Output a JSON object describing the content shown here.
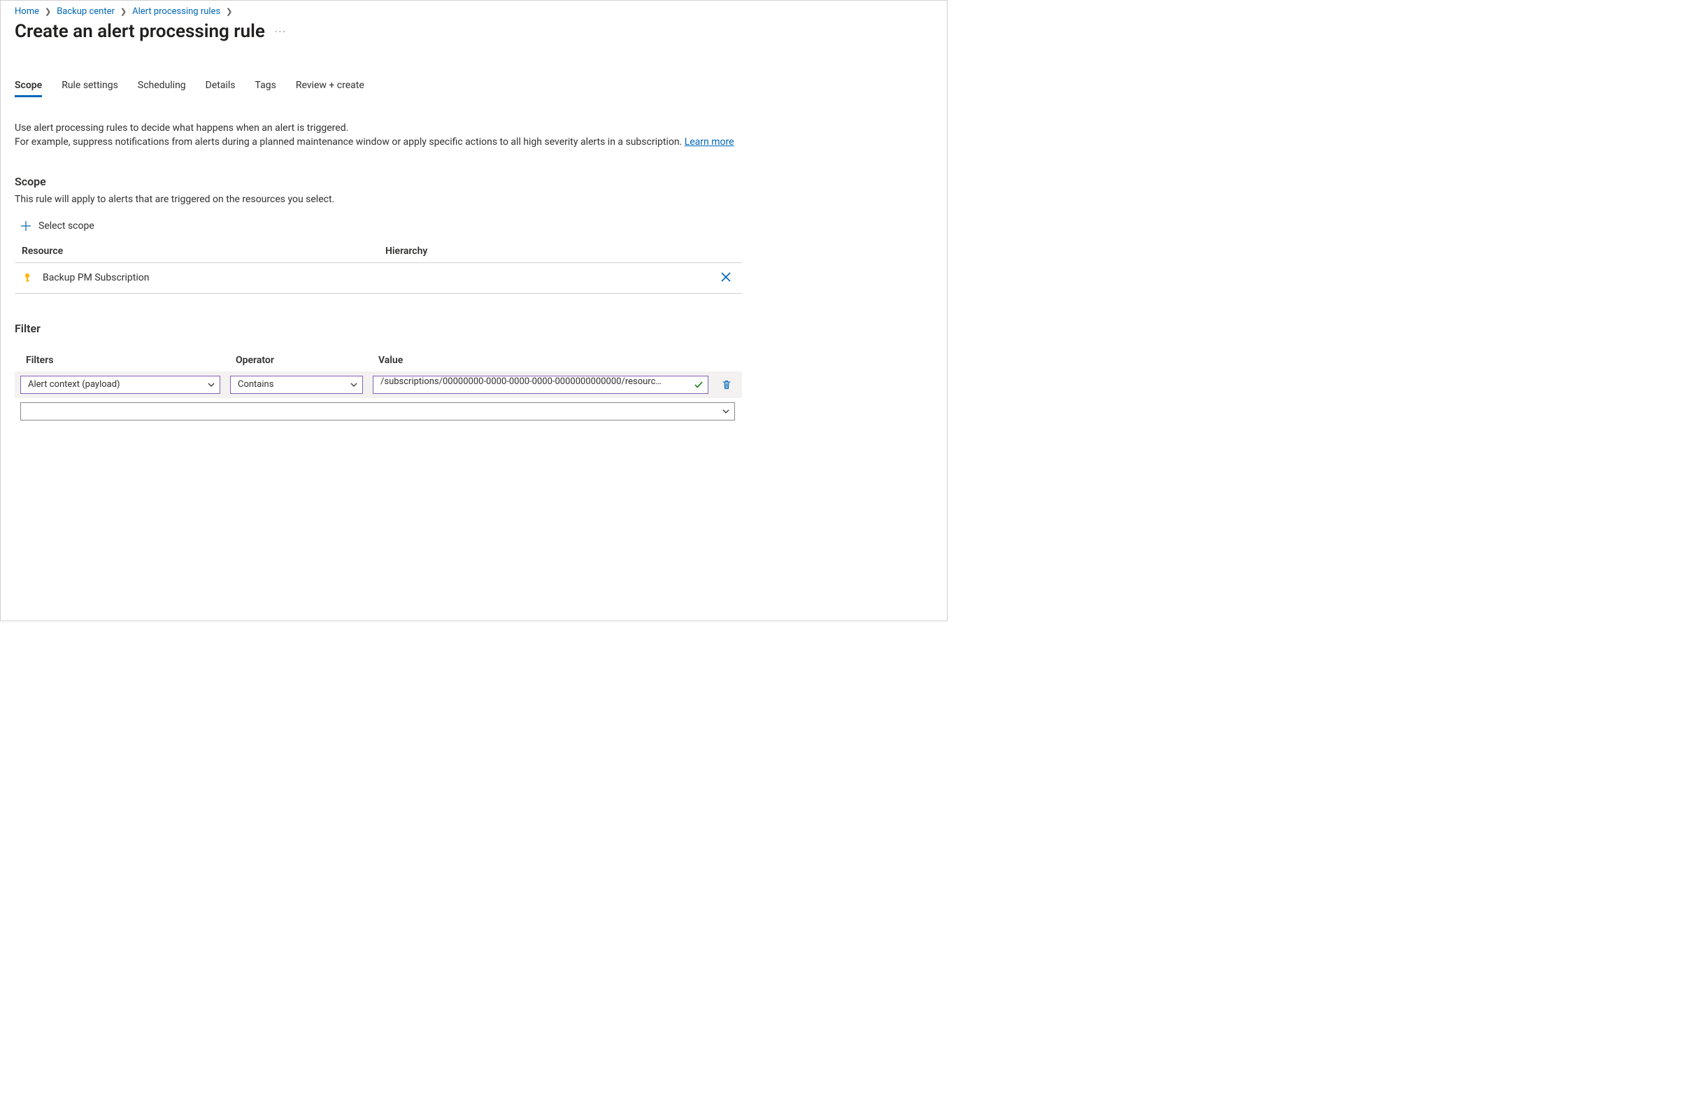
{
  "breadcrumb": {
    "items": [
      {
        "label": "Home"
      },
      {
        "label": "Backup center"
      },
      {
        "label": "Alert processing rules"
      }
    ]
  },
  "page": {
    "title": "Create an alert processing rule"
  },
  "tabs": [
    {
      "label": "Scope",
      "active": true
    },
    {
      "label": "Rule settings"
    },
    {
      "label": "Scheduling"
    },
    {
      "label": "Details"
    },
    {
      "label": "Tags"
    },
    {
      "label": "Review + create"
    }
  ],
  "description": {
    "line1": "Use alert processing rules to decide what happens when an alert is triggered.",
    "line2_pre": "For example, suppress notifications from alerts during a planned maintenance window or apply specific actions to all high severity alerts in a subscription. ",
    "learn_more": "Learn more"
  },
  "scope": {
    "heading": "Scope",
    "subtext": "This rule will apply to alerts that are triggered on the resources you select.",
    "select_label": "Select scope",
    "columns": {
      "resource": "Resource",
      "hierarchy": "Hierarchy"
    },
    "rows": [
      {
        "name": "Backup PM Subscription",
        "icon": "key-icon"
      }
    ]
  },
  "filter": {
    "heading": "Filter",
    "columns": {
      "filters": "Filters",
      "operator": "Operator",
      "value": "Value"
    },
    "rows": [
      {
        "filter": "Alert context (payload)",
        "operator": "Contains",
        "value": "/subscriptions/00000000-0000-0000-0000-0000000000000/resourc…"
      }
    ],
    "new_row_placeholder": ""
  }
}
